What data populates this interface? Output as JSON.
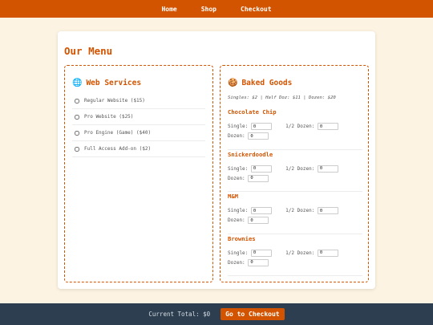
{
  "nav": {
    "home": "Home",
    "shop": "Shop",
    "checkout": "Checkout"
  },
  "page_title": "Our Menu",
  "web_services": {
    "icon": "globe-icon",
    "icon_glyph": "🌐",
    "heading": "Web Services",
    "items": [
      {
        "label": "Regular Website ($15)",
        "checked": false
      },
      {
        "label": "Pro Website ($25)",
        "checked": false
      },
      {
        "label": "Pro Engine (Game) ($40)",
        "checked": false
      },
      {
        "label": "Full Access Add-on ($2)",
        "checked": false
      }
    ]
  },
  "baked_goods": {
    "icon": "cookie-icon",
    "icon_glyph": "🍪",
    "heading": "Baked Goods",
    "prices": "Singles: $2 | Half Doz: $11 | Dozen: $20",
    "single_label": "Single:",
    "half_label": "1/2 Dozen:",
    "dozen_label": "Dozen:",
    "products": [
      {
        "name": "Chocolate Chip",
        "single": "0",
        "half": "0",
        "dozen": "0"
      },
      {
        "name": "Snickerdoodle",
        "single": "0",
        "half": "0",
        "dozen": "0"
      },
      {
        "name": "M&M",
        "single": "0",
        "half": "0",
        "dozen": "0"
      },
      {
        "name": "Brownies",
        "single": "0",
        "half": "0",
        "dozen": "0"
      }
    ]
  },
  "footer": {
    "total": "Current Total: $0",
    "checkout_button": "Go to Checkout"
  },
  "colors": {
    "accent": "#d35400",
    "background": "#fdf3e2",
    "footer": "#2c3e50"
  }
}
